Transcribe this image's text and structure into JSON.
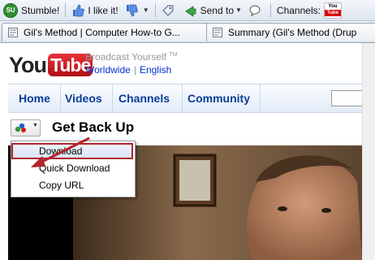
{
  "toolbar": {
    "stumble": "Stumble!",
    "su_icon": "SU",
    "like": "I like it!",
    "send_to": "Send to",
    "channels": "Channels:",
    "yt_mini_top": "You",
    "yt_mini_bottom": "Tube"
  },
  "tabs": [
    {
      "label": "Gil's Method | Computer How-to G..."
    },
    {
      "label": "Summary (Gil's Method (Drup"
    }
  ],
  "youtube": {
    "logo_you": "You",
    "logo_tube": "Tube",
    "tagline": "Broadcast Yourself",
    "tm": "TM",
    "region": "Worldwide",
    "language": "English"
  },
  "nav": {
    "items": [
      "Home",
      "Videos",
      "Channels",
      "Community"
    ]
  },
  "video": {
    "title": "Get Back Up"
  },
  "menu": {
    "items": [
      "Download",
      "Quick Download",
      "Copy URL"
    ],
    "selected": "Download"
  },
  "colors": {
    "callout": "#b2252c",
    "nav_text": "#0a3d99",
    "link": "#0033cc",
    "logo_red": "#d0141a"
  }
}
